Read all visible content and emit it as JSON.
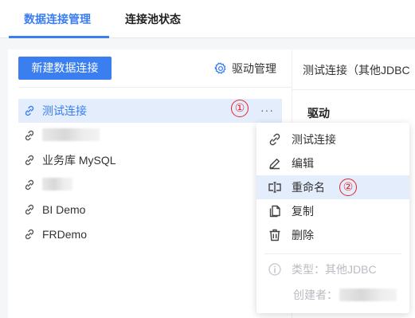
{
  "tabs": [
    {
      "label": "数据连接管理"
    },
    {
      "label": "连接池状态"
    }
  ],
  "toolbar": {
    "new_button": "新建数据连接",
    "driver_label": "驱动管理"
  },
  "connections": [
    {
      "name": "测试连接",
      "selected": true
    },
    {
      "name": "",
      "redacted": true
    },
    {
      "name": "业务库 MySQL"
    },
    {
      "name": "",
      "redacted": true
    },
    {
      "name": "BI Demo"
    },
    {
      "name": "FRDemo"
    }
  ],
  "more_label": "···",
  "annotations": {
    "first": "①",
    "second": "②"
  },
  "right_panel": {
    "title": "测试连接（其他JDBC",
    "driver_label": "驱动"
  },
  "context_menu": {
    "items": [
      {
        "icon": "link-icon",
        "label": "测试连接"
      },
      {
        "icon": "edit-icon",
        "label": "编辑"
      },
      {
        "icon": "rename-icon",
        "label": "重命名",
        "highlighted": true
      },
      {
        "icon": "copy-icon",
        "label": "复制"
      },
      {
        "icon": "trash-icon",
        "label": "删除"
      }
    ],
    "type_label": "类型：其他JDBC",
    "creator_label": "创建者："
  },
  "colors": {
    "accent": "#3a7ef0",
    "selected_bg": "#e3edfb",
    "annotation_red": "#e2242a"
  }
}
